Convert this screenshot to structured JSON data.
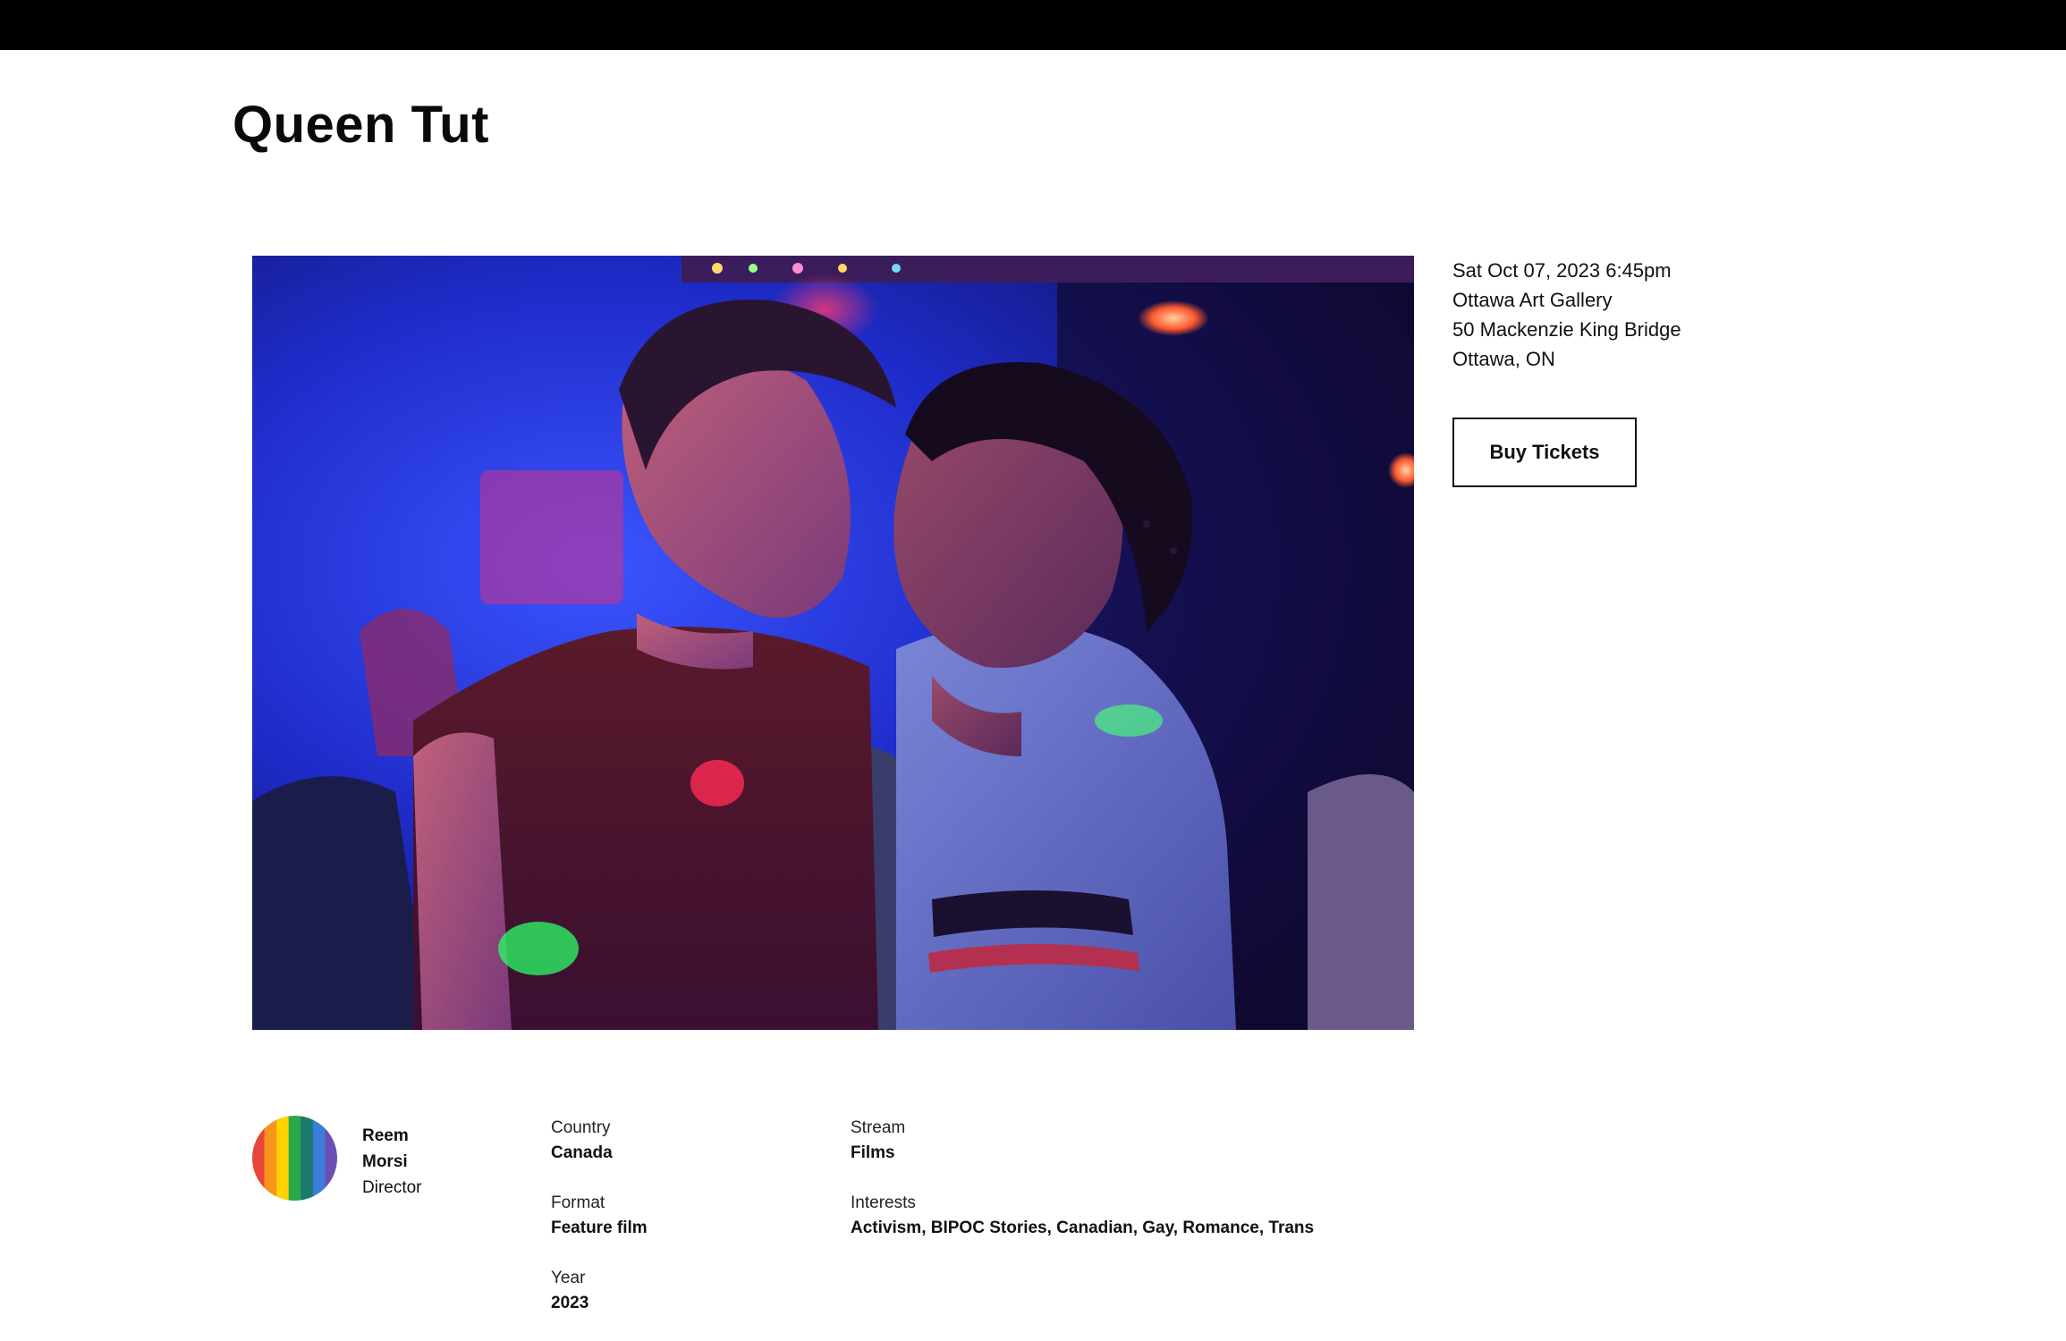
{
  "page": {
    "title": "Queen Tut"
  },
  "event": {
    "datetime": "Sat Oct 07, 2023 6:45pm",
    "venue": "Ottawa Art Gallery",
    "address": "50 Mackenzie King Bridge",
    "city": "Ottawa, ON",
    "buy_label": "Buy Tickets"
  },
  "director": {
    "first_name": "Reem",
    "last_name": "Morsi",
    "role": "Director",
    "avatar_colors": [
      "#e8443a",
      "#f7941d",
      "#ffd200",
      "#2aa84a",
      "#1b7a6e",
      "#3b7dd8",
      "#6b4fb3"
    ]
  },
  "details": {
    "country": {
      "label": "Country",
      "value": "Canada"
    },
    "format": {
      "label": "Format",
      "value": "Feature film"
    },
    "year": {
      "label": "Year",
      "value": "2023"
    },
    "stream": {
      "label": "Stream",
      "value": "Films"
    },
    "interests": {
      "label": "Interests",
      "value": "Activism, BIPOC Stories, Canadian, Gay, Romance, Trans"
    }
  }
}
